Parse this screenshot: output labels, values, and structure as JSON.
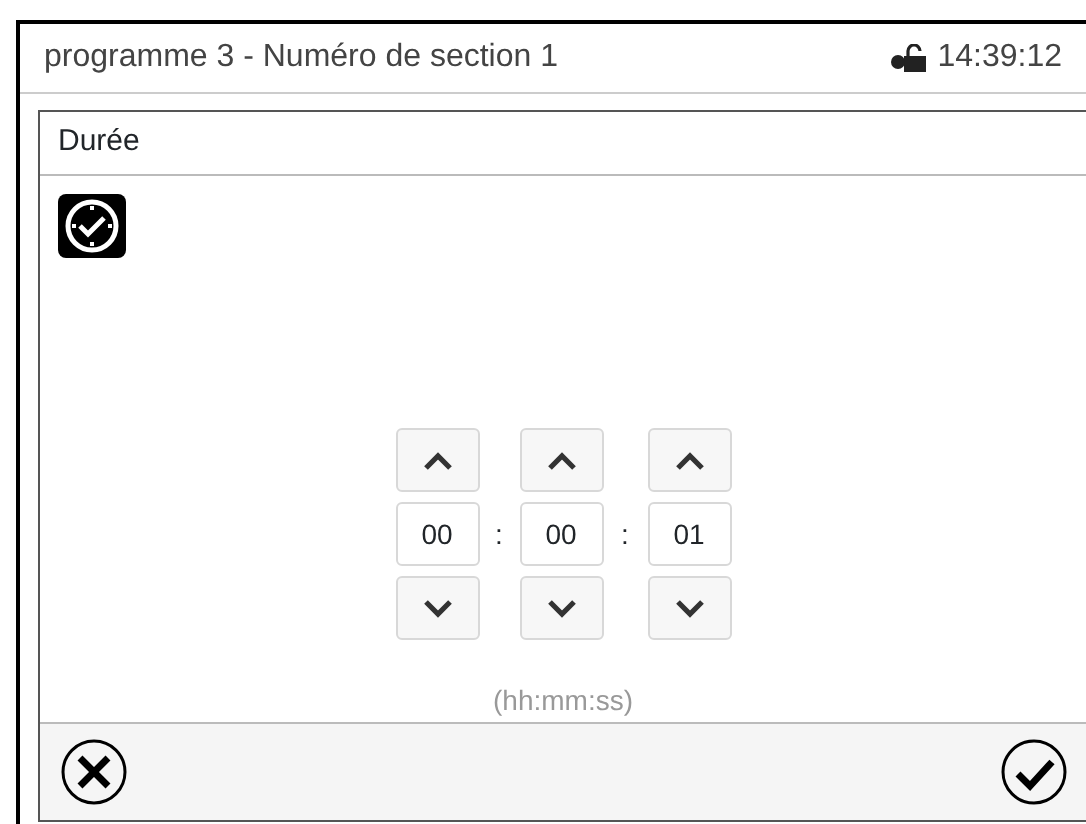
{
  "header": {
    "title": "programme 3 - Numéro de section 1",
    "time": "14:39:12"
  },
  "dialog": {
    "title": "Durée",
    "fields": [
      {
        "value": "00"
      },
      {
        "value": "00"
      },
      {
        "value": "01"
      }
    ],
    "separators": [
      ":",
      ":"
    ],
    "hint": "(hh:mm:ss)"
  }
}
